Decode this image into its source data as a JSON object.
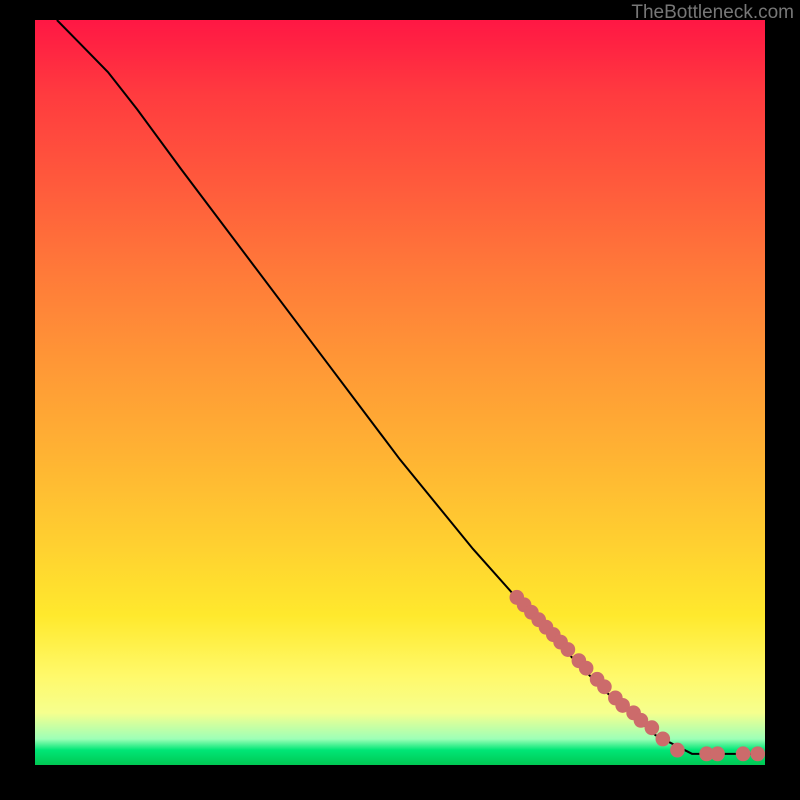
{
  "watermark": "TheBottleneck.com",
  "chart_data": {
    "type": "line",
    "title": "",
    "xlabel": "",
    "ylabel": "",
    "xlim": [
      0,
      100
    ],
    "ylim": [
      0,
      100
    ],
    "curve": [
      {
        "x": 3,
        "y": 100
      },
      {
        "x": 6,
        "y": 97
      },
      {
        "x": 10,
        "y": 93
      },
      {
        "x": 14,
        "y": 88
      },
      {
        "x": 20,
        "y": 80
      },
      {
        "x": 30,
        "y": 67
      },
      {
        "x": 40,
        "y": 54
      },
      {
        "x": 50,
        "y": 41
      },
      {
        "x": 60,
        "y": 29
      },
      {
        "x": 70,
        "y": 18
      },
      {
        "x": 78,
        "y": 10
      },
      {
        "x": 85,
        "y": 4
      },
      {
        "x": 90,
        "y": 1.5
      },
      {
        "x": 93,
        "y": 1.5
      },
      {
        "x": 96,
        "y": 1.5
      },
      {
        "x": 99,
        "y": 1.5
      }
    ],
    "series": [
      {
        "name": "points",
        "color": "#cc6b6b",
        "values": [
          {
            "x": 66,
            "y": 22.5
          },
          {
            "x": 67,
            "y": 21.5
          },
          {
            "x": 68,
            "y": 20.5
          },
          {
            "x": 69,
            "y": 19.5
          },
          {
            "x": 70,
            "y": 18.5
          },
          {
            "x": 71,
            "y": 17.5
          },
          {
            "x": 72,
            "y": 16.5
          },
          {
            "x": 73,
            "y": 15.5
          },
          {
            "x": 74.5,
            "y": 14.0
          },
          {
            "x": 75.5,
            "y": 13.0
          },
          {
            "x": 77,
            "y": 11.5
          },
          {
            "x": 78,
            "y": 10.5
          },
          {
            "x": 79.5,
            "y": 9.0
          },
          {
            "x": 80.5,
            "y": 8.0
          },
          {
            "x": 82,
            "y": 7.0
          },
          {
            "x": 83,
            "y": 6.0
          },
          {
            "x": 84.5,
            "y": 5.0
          },
          {
            "x": 86,
            "y": 3.5
          },
          {
            "x": 88,
            "y": 2.0
          },
          {
            "x": 92,
            "y": 1.5
          },
          {
            "x": 93.5,
            "y": 1.5
          },
          {
            "x": 97,
            "y": 1.5
          },
          {
            "x": 99,
            "y": 1.5
          }
        ]
      }
    ]
  }
}
